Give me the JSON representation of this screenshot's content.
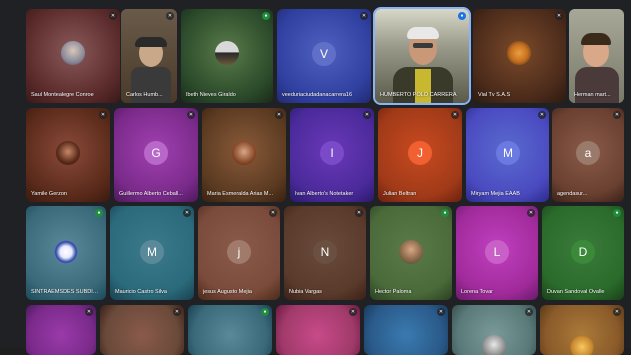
{
  "participants": {
    "row1": [
      {
        "name": "Saul Montealegre Conroe",
        "avatar_type": "photo",
        "bg": "#6b3a3a",
        "mic": "muted"
      },
      {
        "name": "Carlos Humb...",
        "avatar_type": "video",
        "bg": "#5a4a3a",
        "mic": "muted"
      },
      {
        "name": "Ibeth Nieves Giraldo",
        "avatar_type": "photo",
        "bg": "#3d5a3a",
        "mic": "speaking"
      },
      {
        "name": "veeduriaciudadanacarrera16",
        "initial": "V",
        "avatar_type": "letter",
        "bg": "#3848a0",
        "avatar_bg": "#5a6ac8",
        "mic": "muted"
      },
      {
        "name": "HUMBERTO POLO CARRERA",
        "avatar_type": "video",
        "bg": "#8a8a7a",
        "mic": "active"
      },
      {
        "name": "Vial Tv S.A.S",
        "avatar_type": "photo",
        "bg": "#5a3a2a",
        "mic": "muted"
      },
      {
        "name": "Herman mart...",
        "avatar_type": "video",
        "bg": "#7a7a6a",
        "mic": "none"
      }
    ],
    "row2": [
      {
        "name": "Yamile Gerzon",
        "avatar_type": "photo",
        "bg": "#6a3a30",
        "mic": "muted"
      },
      {
        "name": "Guillermo Alberto Ceball...",
        "initial": "G",
        "avatar_type": "letter",
        "bg": "#8a2a9a",
        "avatar_bg": "#b060c0",
        "mic": "muted"
      },
      {
        "name": "Maria Esmeralda Arias M...",
        "avatar_type": "photo",
        "bg": "#6a4a30",
        "mic": "muted"
      },
      {
        "name": "Ivan Alberto's Notetaker",
        "initial": "I",
        "avatar_type": "letter",
        "bg": "#5a2a9a",
        "avatar_bg": "#7a4ac0",
        "mic": "muted"
      },
      {
        "name": "Julian Beltran",
        "initial": "J",
        "avatar_type": "letter",
        "bg": "#a83a1a",
        "avatar_bg": "#e8582a",
        "mic": "muted"
      },
      {
        "name": "Miryam Mejia EAAB",
        "initial": "M",
        "avatar_type": "letter",
        "bg": "#4a4ac0",
        "avatar_bg": "#6a7ae0",
        "mic": "muted"
      },
      {
        "name": "agendasur...",
        "initial": "a",
        "avatar_type": "letter",
        "bg": "#6a4a3a",
        "avatar_bg": "#8a6a5a",
        "mic": "muted"
      }
    ],
    "row3": [
      {
        "name": "SINTRAEMSDES SUBDIR...",
        "avatar_type": "photo",
        "bg": "#3a6a7a",
        "mic": "speaking"
      },
      {
        "name": "Mauricio Castro Silva",
        "initial": "M",
        "avatar_type": "letter",
        "bg": "#2a6a7a",
        "avatar_bg": "#4a8a9a",
        "mic": "muted"
      },
      {
        "name": "jesus Augusto Mejia",
        "initial": "j",
        "avatar_type": "letter",
        "bg": "#7a4a3a",
        "avatar_bg": "#9a6a5a",
        "mic": "muted"
      },
      {
        "name": "Nubia Vargas",
        "initial": "N",
        "avatar_type": "letter",
        "bg": "#5a3a2a",
        "avatar_bg": "#6a5040",
        "mic": "muted"
      },
      {
        "name": "Hector Paloma",
        "avatar_type": "photo",
        "bg": "#4a6a3a",
        "mic": "speaking"
      },
      {
        "name": "Lorena Tovar",
        "initial": "L",
        "avatar_type": "letter",
        "bg": "#a02a9a",
        "avatar_bg": "#c050c0",
        "mic": "muted"
      },
      {
        "name": "Duvan Sandoval Ovalle",
        "initial": "D",
        "avatar_type": "letter",
        "bg": "#2a6a2a",
        "avatar_bg": "#3a8a3a",
        "mic": "speaking"
      }
    ],
    "row4": [
      {
        "bg": "#7a2a8a"
      },
      {
        "bg": "#6a4a3a"
      },
      {
        "bg": "#3a6a7a"
      },
      {
        "bg": "#a03a6a"
      },
      {
        "bg": "#2a5a8a"
      },
      {
        "bg": "#5a7a7a"
      },
      {
        "bg": "#8a5a2a"
      }
    ]
  },
  "icons": {
    "mic_muted": "mic-off-icon",
    "speaking": "audio-wave-icon"
  }
}
